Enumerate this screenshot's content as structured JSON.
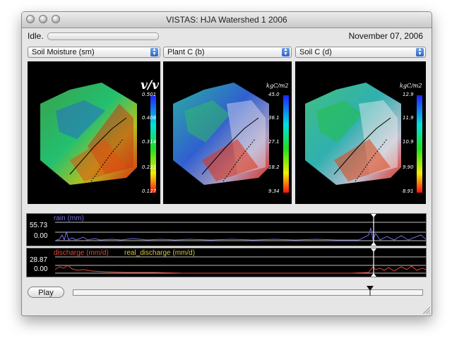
{
  "window": {
    "title": "VISTAS: HJA Watershed 1 2006"
  },
  "status": {
    "text": "Idle.",
    "date": "November 07, 2006"
  },
  "panels": [
    {
      "select": "Soil Moisture (sm)",
      "unit": "v/v",
      "ticks": [
        "0.501",
        "0.408",
        "0.314",
        "0.221",
        "0.127"
      ]
    },
    {
      "select": "Plant C (b)",
      "unit": "kgC/m2",
      "ticks": [
        "45.0",
        "36.1",
        "27.1",
        "18.2",
        "9.34"
      ]
    },
    {
      "select": "Soil C (d)",
      "unit": "kgC/m2",
      "ticks": [
        "12.9",
        "11.9",
        "10.9",
        "9.90",
        "8.91"
      ]
    }
  ],
  "graphs": {
    "rain": {
      "label": "rain (mm)",
      "max": "55.73",
      "min": "0.00",
      "color": "#6f6fe8"
    },
    "discharge": {
      "label": "discharge (mm/d)",
      "label2": "real_discharge (mm/d)",
      "max": "28.87",
      "min": "0.00",
      "color": "#e04a3a",
      "color2": "#d6c93a"
    }
  },
  "controls": {
    "play": "Play",
    "timeline_position": 0.85
  },
  "colors": {
    "window_bg": "#e6e6e6",
    "accent": "#2d63c9"
  }
}
